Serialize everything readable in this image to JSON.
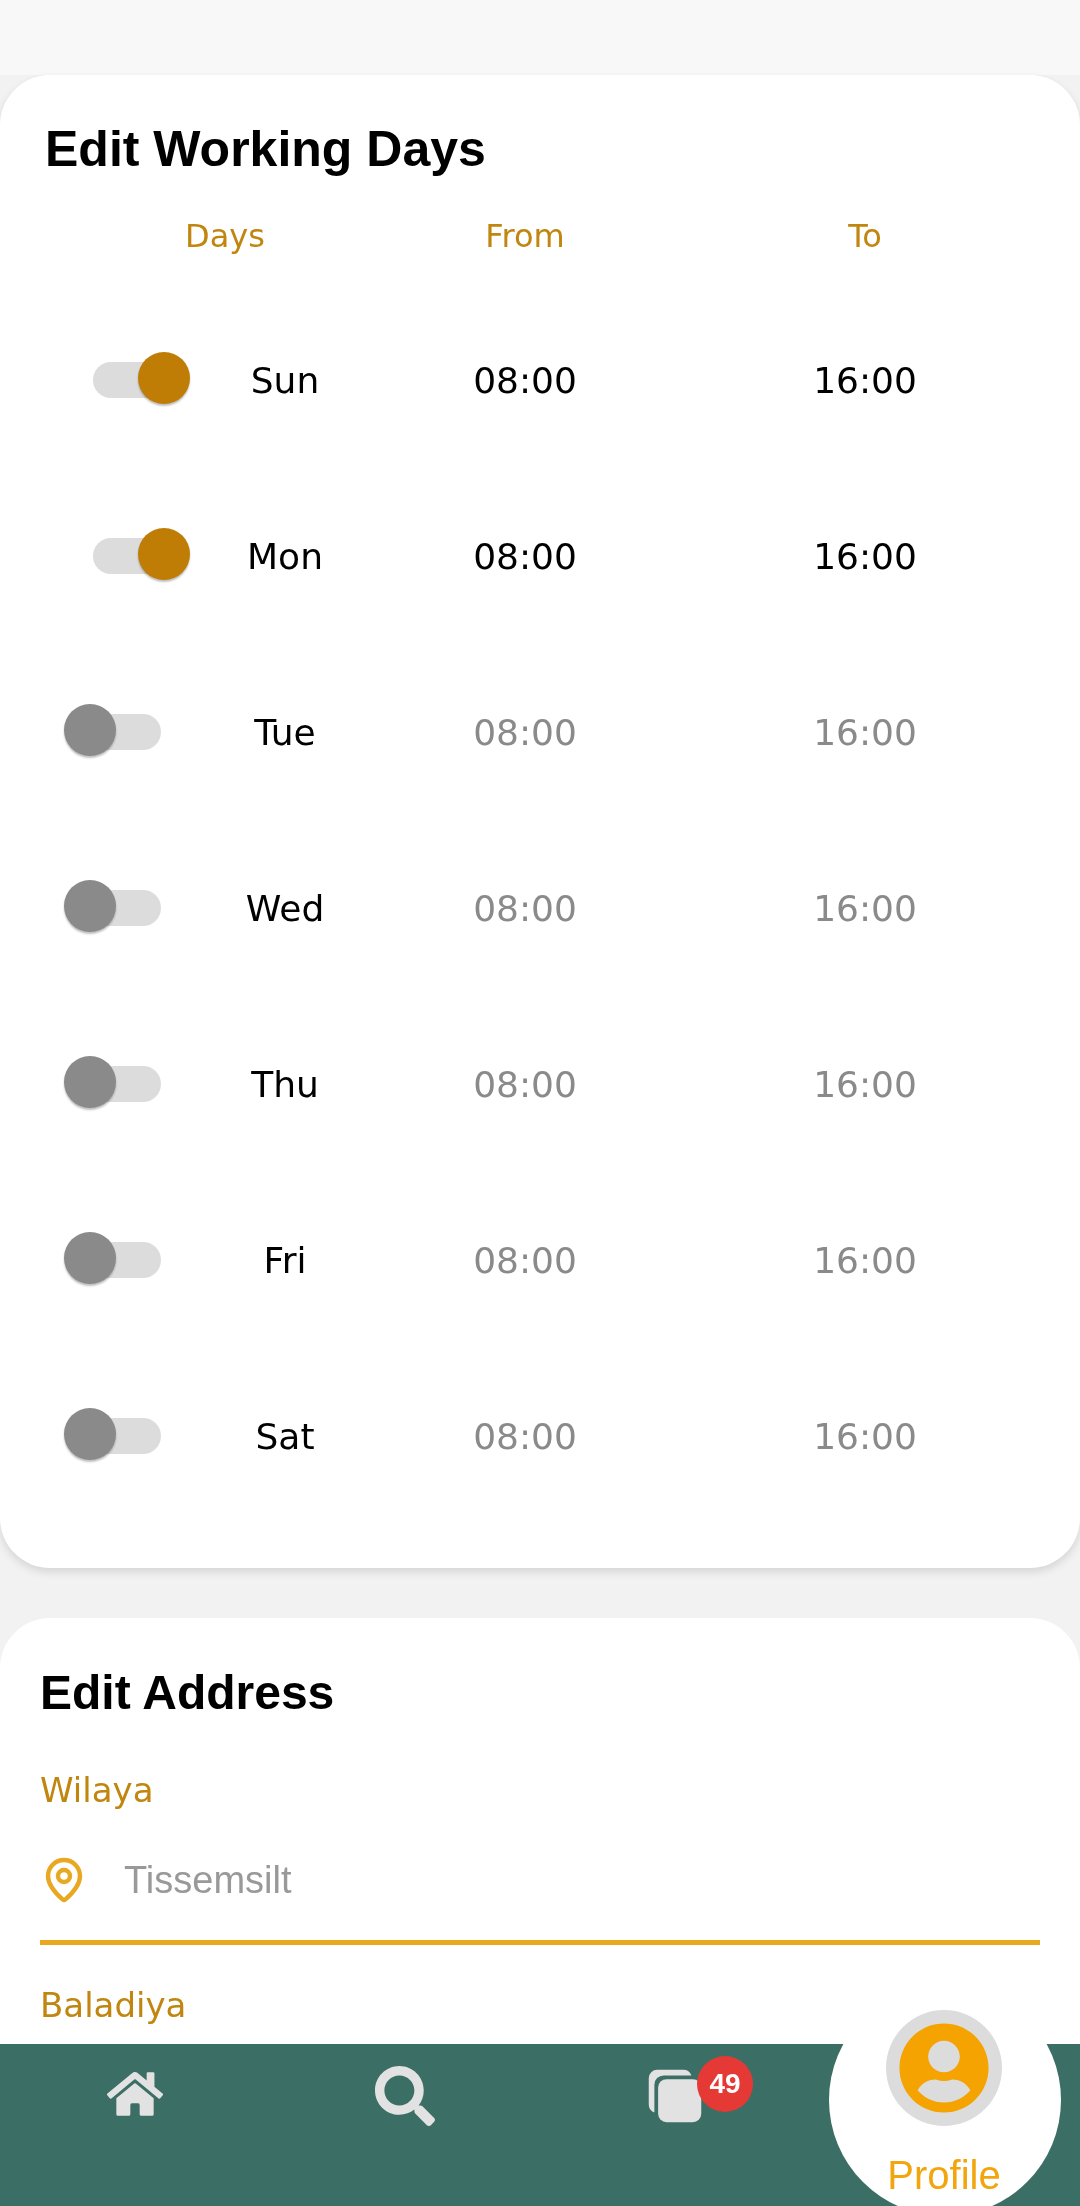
{
  "schedule": {
    "title": "Edit Working Days",
    "columns": [
      "Days",
      "From",
      "To"
    ],
    "days": [
      {
        "name": "Sun",
        "on": true,
        "from": "08:00",
        "to": "16:00"
      },
      {
        "name": "Mon",
        "on": true,
        "from": "08:00",
        "to": "16:00"
      },
      {
        "name": "Tue",
        "on": false,
        "from": "08:00",
        "to": "16:00"
      },
      {
        "name": "Wed",
        "on": false,
        "from": "08:00",
        "to": "16:00"
      },
      {
        "name": "Thu",
        "on": false,
        "from": "08:00",
        "to": "16:00"
      },
      {
        "name": "Fri",
        "on": false,
        "from": "08:00",
        "to": "16:00"
      },
      {
        "name": "Sat",
        "on": false,
        "from": "08:00",
        "to": "16:00"
      }
    ]
  },
  "address": {
    "title": "Edit Address",
    "fields": [
      {
        "label": "Wilaya",
        "value": "Tissemsilt"
      }
    ],
    "next_label": "Baladiya"
  },
  "nav": {
    "items": [
      {
        "kind": "home",
        "selected": false
      },
      {
        "kind": "search",
        "selected": false
      },
      {
        "kind": "documents",
        "selected": false,
        "badge": "49"
      },
      {
        "kind": "profile",
        "selected": true,
        "label": "Profile"
      }
    ]
  }
}
